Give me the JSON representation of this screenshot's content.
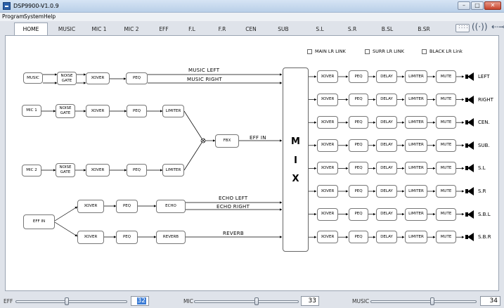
{
  "window": {
    "title": "DSP9900-V1.0.9"
  },
  "menu": [
    "Program",
    "System",
    "Help"
  ],
  "tabs": [
    "HOME",
    "MUSIC",
    "MIC 1",
    "MIC 2",
    "EFF",
    "F.L",
    "F.R",
    "CEN",
    "SUB",
    "S.L",
    "S.R",
    "B.SL",
    "B.SR"
  ],
  "active_tab": "HOME",
  "checkboxes": [
    "MAIN LR LINK",
    "SURR LR LINK",
    "BLACK LR Link"
  ],
  "inputs": {
    "music": {
      "label": "MUSIC",
      "noise_gate": "NOISE GATE",
      "xover": "XOVER",
      "peq": "PEQ"
    },
    "mic1": {
      "label": "MIC 1",
      "noise_gate": "NOISE GATE",
      "xover": "XOVER",
      "peq": "PEQ",
      "limiter": "LIMITER"
    },
    "mic2": {
      "label": "MIC 2",
      "noise_gate": "NOISE GATE",
      "xover": "XOVER",
      "peq": "PEQ",
      "limiter": "LIMITER"
    },
    "fbx": "FBX",
    "eff": {
      "label": "EFF IN",
      "xover_top": "XOVER",
      "peq_top": "PEQ",
      "echo": "ECHO",
      "xover_bot": "XOVER",
      "peq_bot": "PEQ",
      "reverb": "REVERB"
    }
  },
  "signals": {
    "music_left": "MUSIC LEFT",
    "music_right": "MUSIC RIGHT",
    "eff_in": "EFF IN",
    "echo_left": "ECHO LEFT",
    "echo_right": "ECHO RIGHT",
    "reverb": "REVERB"
  },
  "mix": [
    "M",
    "I",
    "X"
  ],
  "chain": [
    "XOVER",
    "PEQ",
    "DELAY",
    "LIMITER",
    "MUTE"
  ],
  "outputs": [
    "LEFT",
    "RIGHT",
    "CEN.",
    "SUB.",
    "S.L",
    "S.R",
    "S.B.L",
    "S.B.R"
  ],
  "sliders": [
    {
      "label": "EFF",
      "value": "32",
      "level": 0.46
    },
    {
      "label": "MIC",
      "value": "33",
      "level": 0.6
    },
    {
      "label": "MUSIC",
      "value": "34",
      "level": 0.58
    }
  ]
}
